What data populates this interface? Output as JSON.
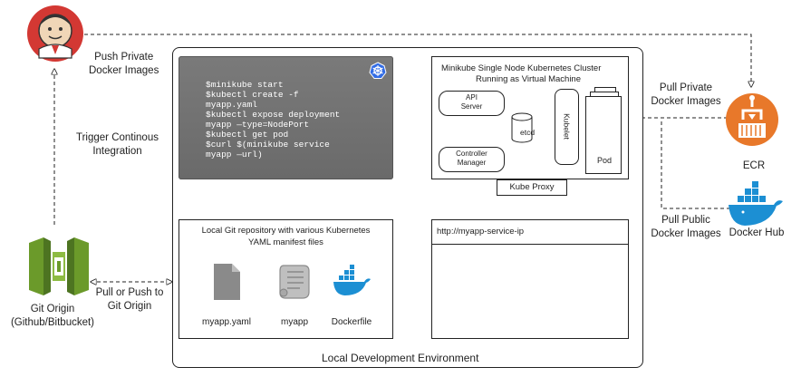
{
  "jenkins": {
    "label_push": "Push Private\nDocker Images",
    "label_trigger": "Trigger Continous\nIntegration"
  },
  "local_env": {
    "title": "Local Development Environment"
  },
  "terminal": {
    "lines": [
      "$minikube start",
      "$kubectl create -f",
      "myapp.yaml",
      "$kubectl expose deployment",
      "myapp —type=NodePort",
      "$kubectl get pod",
      "$curl $(minikube service",
      "myapp —url)"
    ]
  },
  "cluster": {
    "title_line1": "Minikube Single Node  Kubernetes Cluster",
    "title_line2": "Running as Virtual Machine",
    "api_server": "API\nServer",
    "controller_manager": "Controller\nManager",
    "etcd": "etcd",
    "kubelet": "Kubelet",
    "pod": "Pod",
    "kube_proxy": "Kube Proxy"
  },
  "service_box": {
    "url": "http://myapp-service-ip"
  },
  "git_repo": {
    "title_line1": "Local Git repository with various Kubernetes",
    "title_line2": "YAML manifest files",
    "files": [
      "myapp.yaml",
      "myapp",
      "Dockerfile"
    ]
  },
  "git_origin": {
    "name": "Git Origin",
    "sub": "(Github/Bitbucket)",
    "arrow_label": "Pull or Push to\nGit Origin"
  },
  "ecr": {
    "name": "ECR",
    "arrow_label": "Pull Private\nDocker Images"
  },
  "docker_hub": {
    "name": "Docker Hub",
    "arrow_label": "Pull Public\nDocker Images"
  },
  "colors": {
    "ecr_orange": "#e8782a",
    "docker_blue": "#1c8fd3",
    "aws_green": "#6b9a2a",
    "terminal_gray": "#6f6f6f",
    "kube_blue": "#326ce5"
  }
}
